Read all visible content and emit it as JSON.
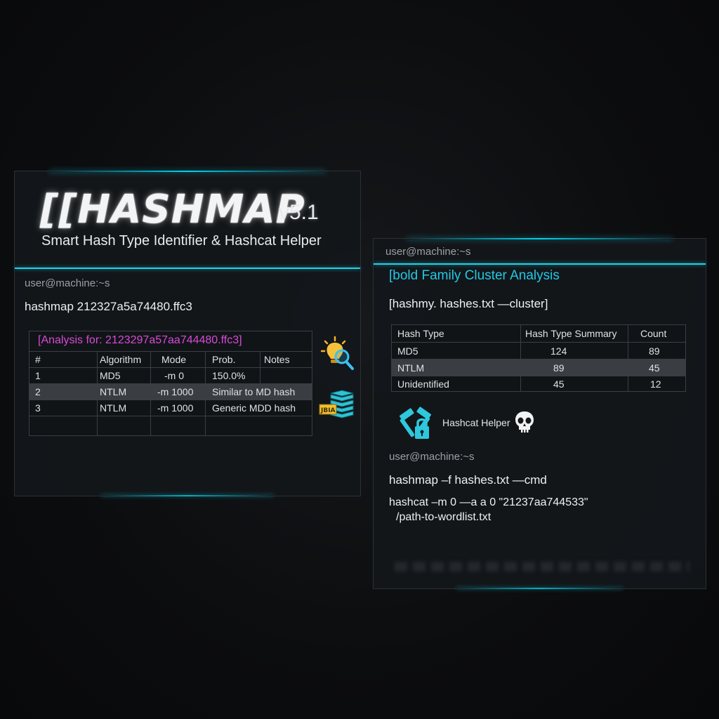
{
  "left_panel": {
    "logo": "[[HASHMAP",
    "version": "v5.1",
    "tagline": "Smart Hash Type Identifier & Hashcat Helper",
    "prompt": "user@machine:~s",
    "command": "hashmap 212327a5a74480.ffc3",
    "analysis": {
      "title": "[Analysis for: 2123297a57aa744480.ffc3]",
      "headers": [
        "#",
        "Algorithm",
        "Mode",
        "Prob.",
        "Notes"
      ],
      "rows": [
        {
          "num": "1",
          "algorithm": "MD5",
          "mode": "-m 0",
          "prob": "150.0%",
          "notes": ""
        },
        {
          "num": "2",
          "algorithm": "NTLM",
          "mode": "-m 1000",
          "prob": "Similar to MD hash",
          "notes": ""
        },
        {
          "num": "3",
          "algorithm": "NTLM",
          "mode": "-m 1000",
          "prob": "Generic  MDD hash",
          "notes": ""
        }
      ]
    },
    "icons": [
      "lightbulb-search-icon",
      "database-stack-icon"
    ],
    "db_badge": "JBIA"
  },
  "right_panel": {
    "prompt": "user@machine:~s",
    "section_title": "[bold Family Cluster Analysis",
    "command": "[hashmy. hashes.txt —cluster]",
    "cluster_table": {
      "headers": [
        "Hash Type",
        "Hash Type Summary",
        "Count"
      ],
      "rows": [
        {
          "type": "MD5",
          "summary": "124",
          "count": "89"
        },
        {
          "type": "NTLM",
          "summary": "89",
          "count": "45"
        },
        {
          "type": "Unidentified",
          "summary": "45",
          "count": "12"
        }
      ]
    },
    "helper": {
      "label": "Hashcat Helper",
      "icons": [
        "hammer-lock-icon",
        "skull-icon"
      ]
    },
    "prompt2": "user@machine:~s",
    "command2": "hashmap –f hashes.txt —cmd",
    "output_line1": "hashcat –m 0 —a a 0 \"21237aa744533\"",
    "output_line2": "/path-to-wordlist.txt"
  },
  "colors": {
    "accent": "#1fd3ea",
    "analysis_title": "#d74ad8",
    "section_title": "#22c8e5",
    "background": "#0c0d0f"
  }
}
